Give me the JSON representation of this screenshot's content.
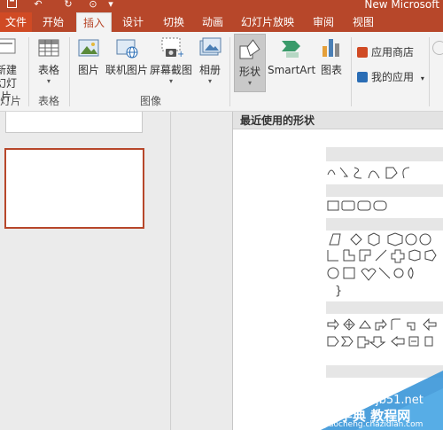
{
  "window": {
    "title": "New Microsoft",
    "qat": [
      {
        "name": "save-icon",
        "glyph": "💾"
      },
      {
        "name": "undo-icon",
        "glyph": "↶"
      },
      {
        "name": "redo-icon",
        "glyph": "↻"
      },
      {
        "name": "present-icon",
        "glyph": "⊙"
      }
    ]
  },
  "tabs": [
    {
      "label": "文件"
    },
    {
      "label": "开始"
    },
    {
      "label": "插入"
    },
    {
      "label": "设计"
    },
    {
      "label": "切换"
    },
    {
      "label": "动画"
    },
    {
      "label": "幻灯片放映"
    },
    {
      "label": "审阅"
    },
    {
      "label": "视图"
    }
  ],
  "ribbon": {
    "slides_group": {
      "button_top": "新建",
      "button_bottom": "幻灯片",
      "label": "幻灯片"
    },
    "tables_group": {
      "button": "表格",
      "label": "表格"
    },
    "images_group": {
      "buttons": [
        "图片",
        "联机图片",
        "屏幕截图",
        "相册"
      ],
      "label": "图像"
    },
    "illustrations": {
      "shapes": "形状",
      "smartart": "SmartArt",
      "chart": "图表"
    },
    "apps": {
      "store": "应用商店",
      "my_apps": "我的应用"
    },
    "shapes_recent_header": "最近使用的形状"
  },
  "watermark": {
    "line1": "jb51.net",
    "line2": "查字典 教程网",
    "line3": "jiaocheng.chazidian.com"
  },
  "colors": {
    "accent": "#b7472a",
    "ribbon_bg": "#f3f3f3"
  }
}
